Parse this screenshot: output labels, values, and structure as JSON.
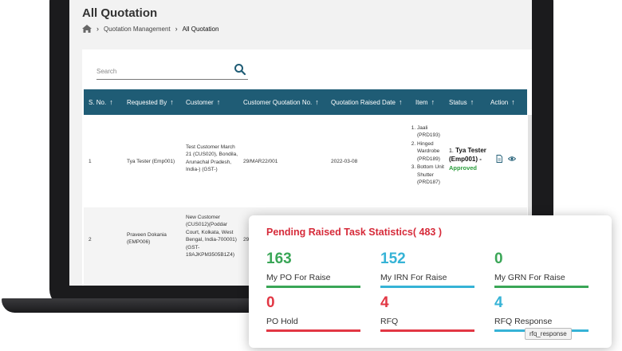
{
  "page": {
    "title": "All Quotation",
    "breadcrumb": {
      "level1": "Quotation Management",
      "current": "All Quotation"
    }
  },
  "search": {
    "placeholder": "Search"
  },
  "table": {
    "columns": [
      "S. No.",
      "Requested By",
      "Customer",
      "Customer Quotation No.",
      "Quotation Raised Date",
      "Item",
      "Status",
      "Action"
    ],
    "sort_glyph": "↑",
    "rows": [
      {
        "sno": "1",
        "requested_by": "Tya Tester (Emp001)",
        "customer": "Test Customer March 21 (CUS020), Bondila, Arunachal Pradesh, India-) (GST-)",
        "quotation_no": "29/MAR22/001",
        "raised_date": "2022-03-08",
        "items": [
          "Jaali (PRD193)",
          "Hinged Wardrobe (PRD189)",
          "Bottom Unit Shutter (PRD187)"
        ],
        "status_index": "1.",
        "status_name": "Tya Tester (Emp001) -",
        "status_state": "Approved"
      },
      {
        "sno": "2",
        "requested_by": "Praveen Dokania (EMP006)",
        "customer": "New Customer (CUS012)(Poddar Court, Kolkata, West Bengal, India-700001)(GST-19AJKPM3505B1Z4)",
        "quotation_no": "29/",
        "raised_date": "",
        "items": [],
        "status_index": "",
        "status_name": "",
        "status_state": ""
      }
    ]
  },
  "stats": {
    "title": "Pending Raised Task Statistics( 483 )",
    "items": [
      {
        "value": "163",
        "label": "My PO For Raise",
        "color": "#3aa657"
      },
      {
        "value": "152",
        "label": "My IRN For Raise",
        "color": "#36b3d6"
      },
      {
        "value": "0",
        "label": "My GRN For Raise",
        "color": "#3aa657"
      },
      {
        "value": "0",
        "label": "PO Hold",
        "color": "#e23744"
      },
      {
        "value": "4",
        "label": "RFQ",
        "color": "#e23744"
      },
      {
        "value": "4",
        "label": "RFQ Response",
        "color": "#36b3d6"
      }
    ],
    "tooltip": "rfq_response"
  },
  "icons": {
    "home": "home-icon",
    "breadcrumb_separator": "chevron-right-icon",
    "search": "search-icon",
    "pdf": "pdf-icon",
    "view": "eye-icon"
  }
}
